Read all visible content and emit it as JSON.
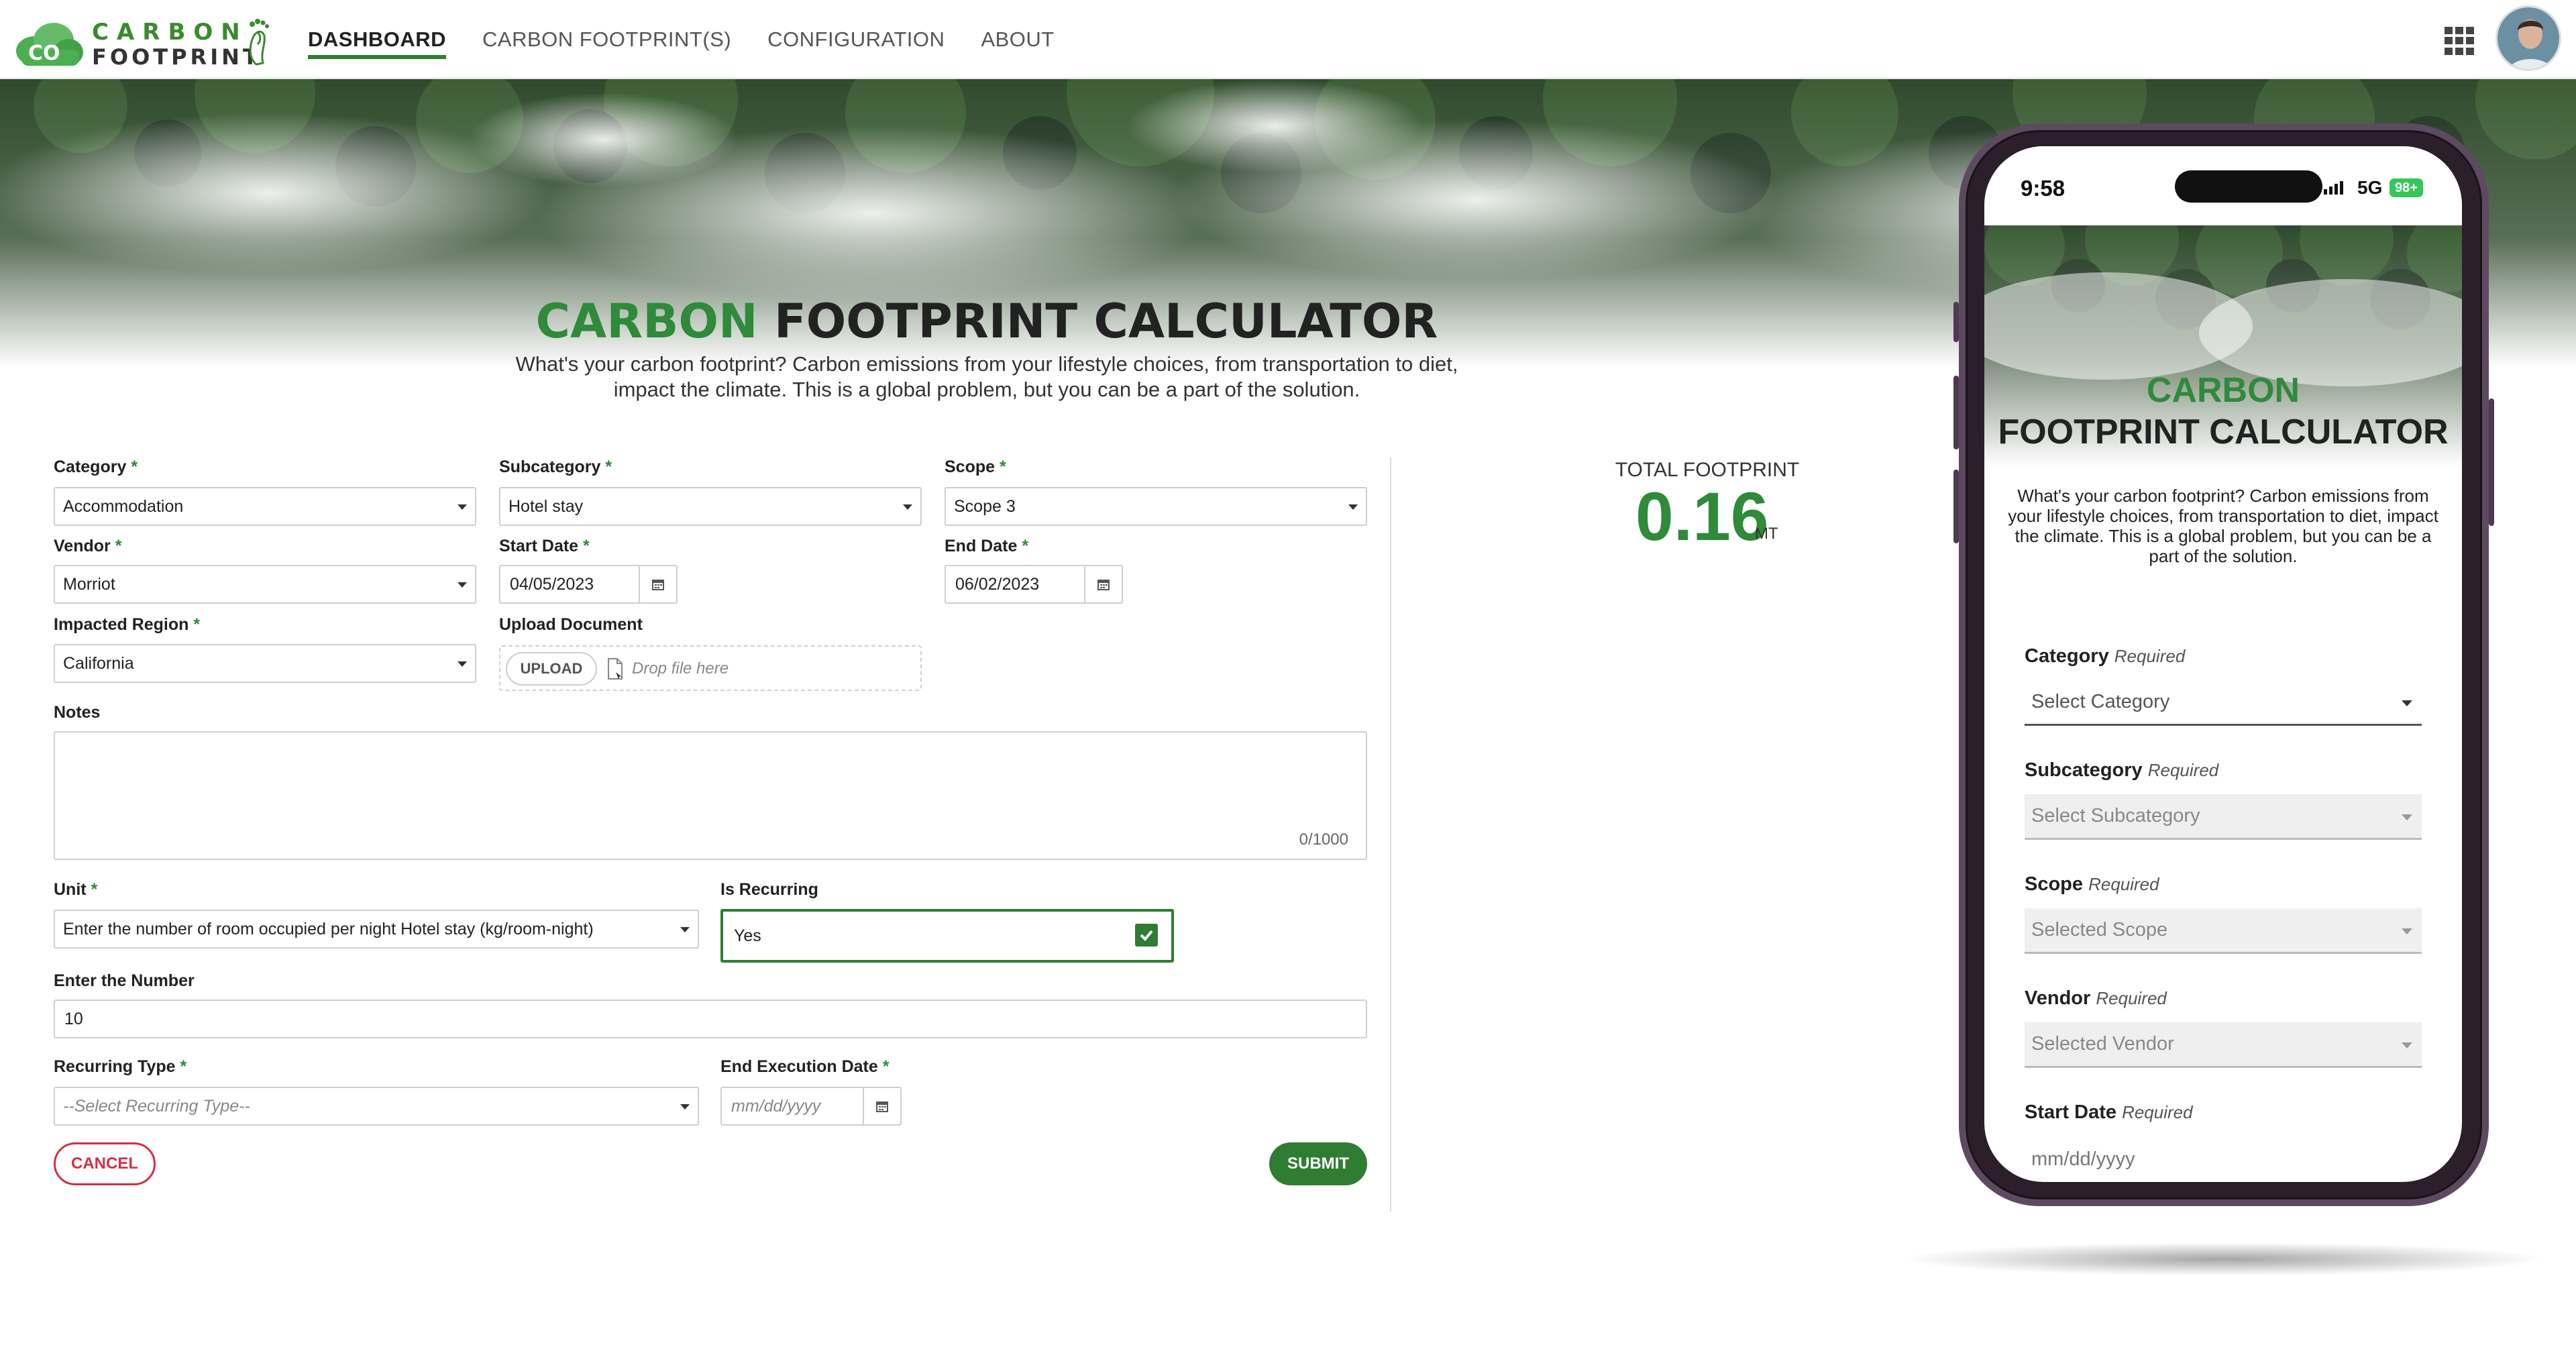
{
  "header": {
    "logo_line1": "CARBON",
    "logo_line2": "FOOTPRINT",
    "logo_badge": "CO",
    "nav": [
      "DASHBOARD",
      "CARBON FOOTPRINT(S)",
      "CONFIGURATION",
      "ABOUT"
    ],
    "active_nav": "DASHBOARD"
  },
  "hero": {
    "title_green": "CARBON",
    "title_rest": "FOOTPRINT CALCULATOR",
    "description": "What's your carbon footprint? Carbon emissions from your lifestyle choices, from transportation to diet, impact the climate. This is a global problem, but you can be a part of the solution."
  },
  "form": {
    "required_mark": "*",
    "category": {
      "label": "Category",
      "value": "Accommodation"
    },
    "subcategory": {
      "label": "Subcategory",
      "value": "Hotel stay"
    },
    "scope": {
      "label": "Scope",
      "value": "Scope 3"
    },
    "vendor": {
      "label": "Vendor",
      "value": "Morriot"
    },
    "start_date": {
      "label": "Start Date",
      "value": "04/05/2023"
    },
    "end_date": {
      "label": "End Date",
      "value": "06/02/2023"
    },
    "impacted_region": {
      "label": "Impacted Region",
      "value": "California"
    },
    "upload": {
      "label": "Upload Document",
      "button": "UPLOAD",
      "placeholder": "Drop file here"
    },
    "notes": {
      "label": "Notes",
      "value": "",
      "counter": "0/1000"
    },
    "unit": {
      "label": "Unit",
      "value": "Enter the number of room occupied per night Hotel stay (kg/room-night)"
    },
    "is_recurring": {
      "label": "Is Recurring",
      "value": "Yes",
      "checked": true
    },
    "number": {
      "label": "Enter the Number",
      "value": "10"
    },
    "recurring_type": {
      "label": "Recurring Type",
      "placeholder": "--Select Recurring Type--"
    },
    "end_execution_date": {
      "label": "End Execution Date",
      "placeholder": "mm/dd/yyyy"
    },
    "cancel": "CANCEL",
    "submit": "SUBMIT"
  },
  "total": {
    "label": "TOTAL FOOTPRINT",
    "value": "0.16",
    "unit": "MT"
  },
  "phone": {
    "time": "9:58",
    "network": "5G",
    "battery": "98+",
    "title_line1": "CARBON",
    "title_line2": "FOOTPRINT CALCULATOR",
    "description": "What's your carbon footprint? Carbon emissions from your lifestyle choices, from transportation to diet, impact the climate. This is a global problem, but you can be a part of the solution.",
    "required_text": "Required",
    "fields": [
      {
        "label": "Category",
        "placeholder": "Select Category"
      },
      {
        "label": "Subcategory",
        "placeholder": "Select Subcategory"
      },
      {
        "label": "Scope",
        "placeholder": "Selected Scope"
      },
      {
        "label": "Vendor",
        "placeholder": "Selected Vendor"
      },
      {
        "label": "Start Date",
        "placeholder": "mm/dd/yyyy"
      }
    ]
  },
  "colors": {
    "brand_green": "#2f8a3a",
    "button_green": "#2f7d32",
    "cancel_red": "#d32f47"
  },
  "icons": [
    "apps-grid-icon",
    "avatar",
    "calendar-icon",
    "file-icon",
    "check-icon",
    "chevron-down-icon",
    "footprint-icon",
    "cloud-logo-icon"
  ]
}
